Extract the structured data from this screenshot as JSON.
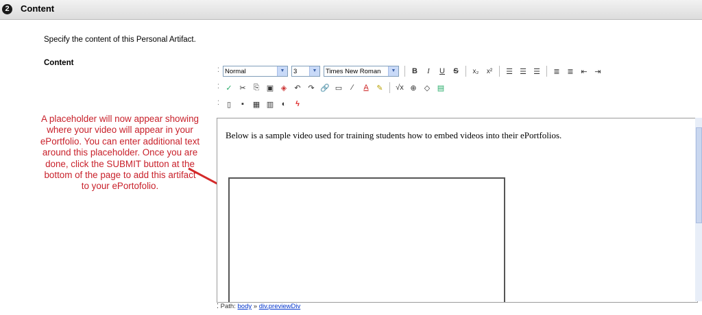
{
  "section": {
    "step": "2",
    "title": "Content"
  },
  "instructions": "Specify the content of this Personal Artifact.",
  "field_label": "Content",
  "toolbar": {
    "format_select": "Normal",
    "size_select": "3",
    "font_select": "Times New Roman",
    "bold": "B",
    "italic": "I",
    "underline": "U",
    "strike": "S",
    "subscript": "x₂",
    "superscript": "x²"
  },
  "editor": {
    "body_text": "Below is a sample video used for training students how to embed videos into their ePortfolios."
  },
  "annotation": "A placeholder will now appear showing where your video will appear in your ePortfolio.  You can enter additional text around this placeholder. Once you are done, click the SUBMIT button at the bottom of the page to add this artifact to your ePortofolio.",
  "statusbar": {
    "label": "Path:",
    "crumb1": "body",
    "sep": "»",
    "crumb2": "div.previewDiv"
  },
  "colors": {
    "annotation": "#c8202a",
    "arrow": "#d42a2a",
    "link": "#0033cc"
  }
}
